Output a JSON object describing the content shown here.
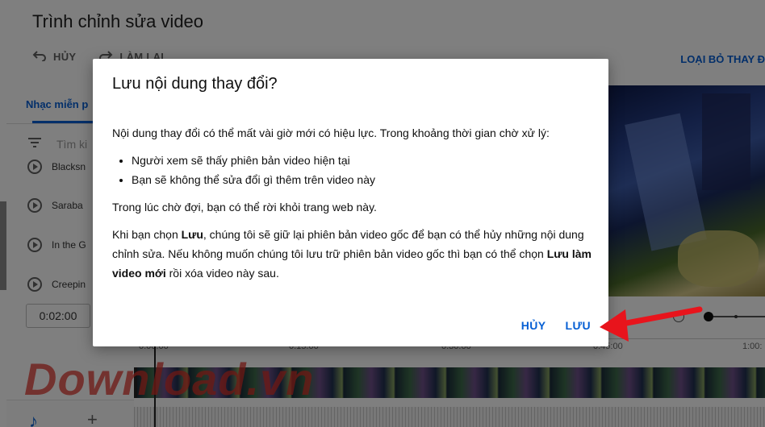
{
  "page": {
    "title": "Trình chỉnh sửa video",
    "undo_label": "HỦY",
    "redo_label": "LÀM LẠI",
    "discard_label": "LOẠI BỎ THAY Đ",
    "tab_music": "Nhạc miễn p",
    "search_placeholder": "Tìm ki",
    "tracks": [
      "Blacksn",
      "Saraba",
      "In the G",
      "Creepin"
    ],
    "time_value": "0:02:00",
    "ticks": [
      "0:00:00",
      "0:15:00",
      "0:30:00",
      "0:45:00",
      "1:00:"
    ],
    "watermark": "Download.vn"
  },
  "dialog": {
    "title": "Lưu nội dung thay đổi?",
    "intro": "Nội dung thay đổi có thể mất vài giờ mới có hiệu lực. Trong khoảng thời gian chờ xử lý:",
    "bullets": [
      "Người xem sẽ thấy phiên bản video hiện tại",
      "Bạn sẽ không thể sửa đổi gì thêm trên video này"
    ],
    "wait_note": "Trong lúc chờ đợi, bạn có thể rời khỏi trang web này.",
    "p3_a": "Khi bạn chọn ",
    "p3_b": "Lưu",
    "p3_c": ", chúng tôi sẽ giữ lại phiên bản video gốc để bạn có thể hủy những nội dung chỉnh sửa. Nếu không muốn chúng tôi lưu trữ phiên bản video gốc thì bạn có thể chọn ",
    "p3_d": "Lưu làm video mới",
    "p3_e": " rồi xóa video này sau.",
    "cancel_label": "HỦY",
    "save_label": "LƯU"
  },
  "colors": {
    "accent": "#065fd4",
    "arrow": "#e8141c"
  }
}
